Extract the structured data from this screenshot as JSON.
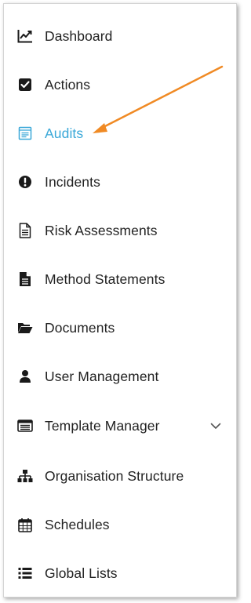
{
  "sidebar": {
    "items": [
      {
        "label": "Dashboard",
        "icon": "line-chart-icon"
      },
      {
        "label": "Actions",
        "icon": "checkbox-icon"
      },
      {
        "label": "Audits",
        "icon": "clipboard-list-icon",
        "active": true
      },
      {
        "label": "Incidents",
        "icon": "exclamation-circle-icon"
      },
      {
        "label": "Risk Assessments",
        "icon": "document-outline-icon"
      },
      {
        "label": "Method Statements",
        "icon": "document-filled-icon"
      },
      {
        "label": "Documents",
        "icon": "folder-open-icon"
      },
      {
        "label": "User Management",
        "icon": "user-icon"
      },
      {
        "label": "Template Manager",
        "icon": "window-list-icon",
        "expandable": true
      },
      {
        "label": "Organisation Structure",
        "icon": "sitemap-icon"
      },
      {
        "label": "Schedules",
        "icon": "calendar-icon"
      },
      {
        "label": "Global Lists",
        "icon": "list-icon"
      }
    ]
  },
  "colors": {
    "active": "#3aa8d8",
    "text": "#222222",
    "icon": "#1a1a1a",
    "annotation_arrow": "#f08a24"
  }
}
